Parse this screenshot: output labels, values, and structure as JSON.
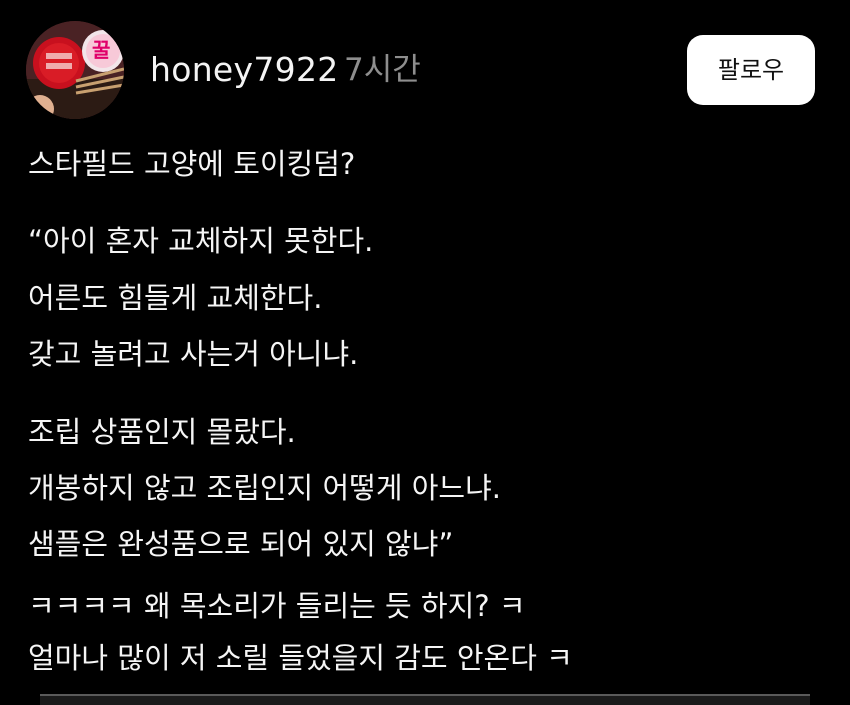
{
  "post": {
    "username": "honey7922",
    "timestamp": "7시간",
    "follow_label": "팔로우",
    "avatar_icon": "avatar-photo-icon",
    "avatar_text": "꿀",
    "title": "스타필드 고양에 토이킹덤?",
    "paragraph1": [
      "“아이 혼자 교체하지 못한다.",
      "어른도 힘들게 교체한다.",
      "갖고 놀려고 사는거 아니냐."
    ],
    "paragraph2": [
      "조립 상품인지 몰랐다.",
      "개봉하지 않고 조립인지 어떻게 아느냐.",
      "샘플은 완성품으로 되어 있지 않냐”"
    ],
    "paragraph3": [
      "ㅋㅋㅋㅋ 왜 목소리가 들리는 듯 하지? ㅋ",
      "얼마나 많이 저 소릴 들었을지 감도 안온다 ㅋ"
    ]
  },
  "colors": {
    "background": "#000000",
    "text": "#f5f5f5",
    "muted": "#8e8e8e",
    "button_bg": "#ffffff",
    "button_text": "#111111"
  }
}
